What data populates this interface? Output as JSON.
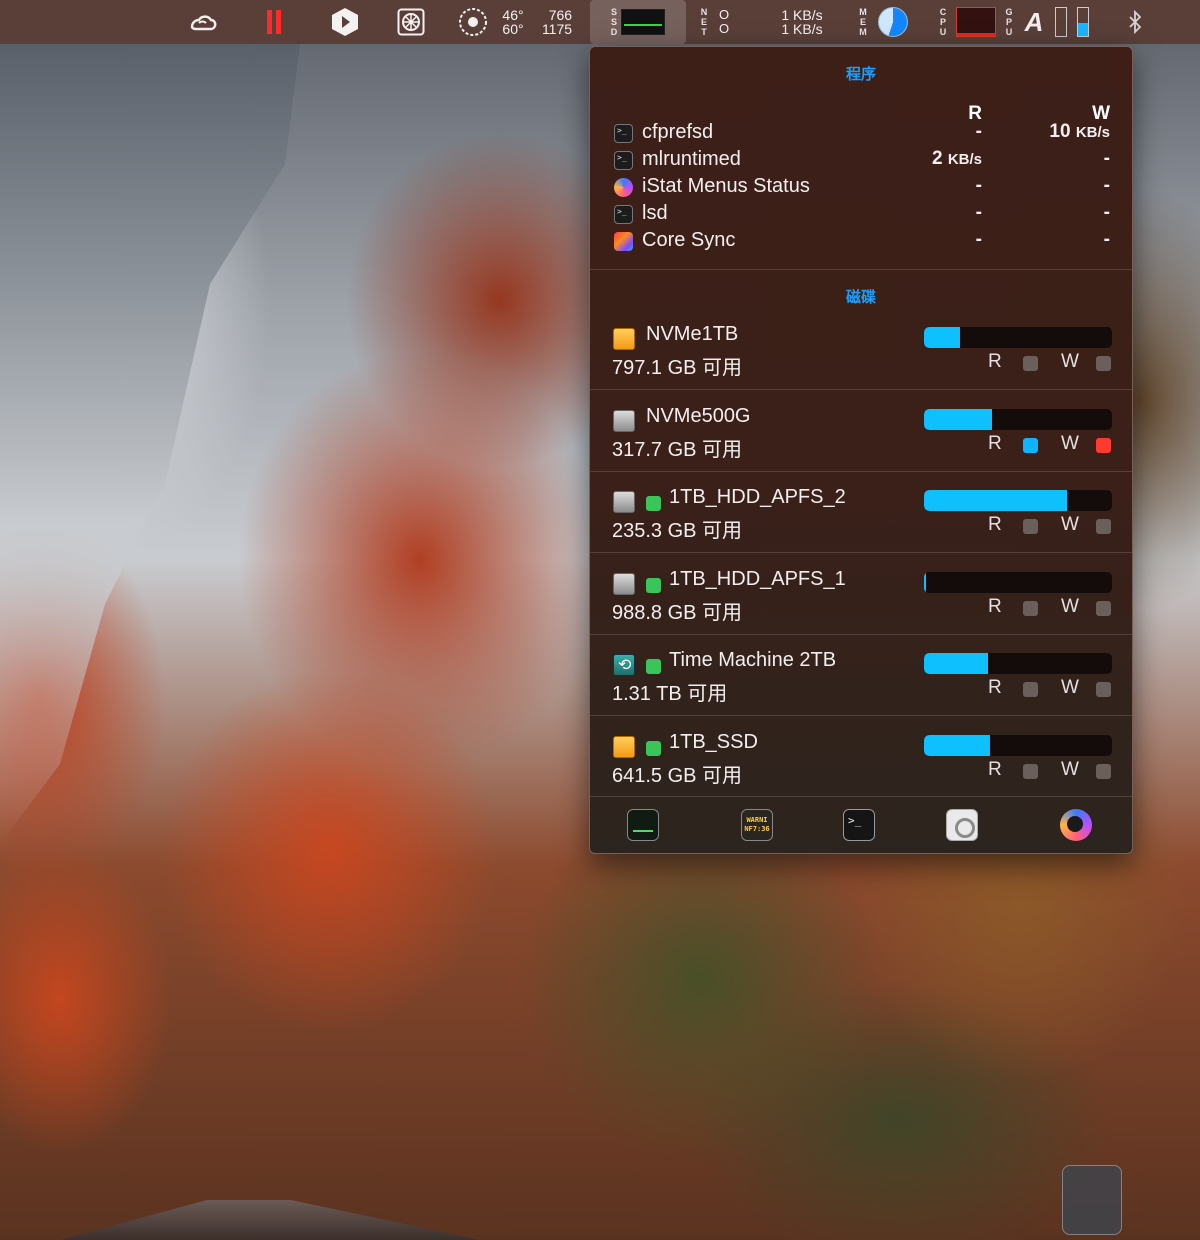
{
  "menubar": {
    "temps": [
      "46°",
      "60°"
    ],
    "fans": [
      "766",
      "1175"
    ],
    "ssd_label": [
      "S",
      "S",
      "D"
    ],
    "net_label": [
      "N",
      "E",
      "T"
    ],
    "net_dots": [
      "O",
      "O"
    ],
    "net_rates": [
      "1 KB/s",
      "1 KB/s"
    ],
    "mem_label": [
      "M",
      "E",
      "M"
    ],
    "cpu_label": [
      "C",
      "P",
      "U"
    ],
    "gpu_label": [
      "G",
      "P",
      "U"
    ],
    "font_icon": "A",
    "memory_fraction": 0.55,
    "gpu_fraction": 0.45
  },
  "panel": {
    "processes_title": "程序",
    "col_read": "R",
    "col_write": "W",
    "processes": [
      {
        "name": "cfprefsd",
        "icon": "terminal-icon",
        "read": "-",
        "write_value": "10",
        "write_unit": "KB/s"
      },
      {
        "name": "mlruntimed",
        "icon": "terminal-icon",
        "read_value": "2",
        "read_unit": "KB/s",
        "write": "-"
      },
      {
        "name": "iStat Menus Status",
        "icon": "istat-icon",
        "read": "-",
        "write": "-"
      },
      {
        "name": "lsd",
        "icon": "terminal-icon",
        "read": "-",
        "write": "-"
      },
      {
        "name": "Core Sync",
        "icon": "creative-cloud-icon",
        "read": "-",
        "write": "-"
      }
    ],
    "disks_title": "磁碟",
    "rw_read": "R",
    "rw_write": "W",
    "disks": [
      {
        "name": "NVMe1TB",
        "free": "797.1 GB 可用",
        "icon": "orange-disk-icon",
        "mounted_dot": false,
        "used_fraction": 0.19,
        "read_active": false,
        "write_active": false
      },
      {
        "name": "NVMe500G",
        "free": "317.7 GB 可用",
        "icon": "grey-disk-icon",
        "mounted_dot": false,
        "used_fraction": 0.36,
        "read_active": true,
        "write_active": true
      },
      {
        "name": "1TB_HDD_APFS_2",
        "free": "235.3 GB 可用",
        "icon": "grey-disk-icon",
        "mounted_dot": true,
        "used_fraction": 0.76,
        "read_active": false,
        "write_active": false
      },
      {
        "name": "1TB_HDD_APFS_1",
        "free": "988.8 GB 可用",
        "icon": "grey-disk-icon",
        "mounted_dot": true,
        "used_fraction": 0.01,
        "read_active": false,
        "write_active": false
      },
      {
        "name": "Time Machine 2TB",
        "free": "1.31 TB 可用",
        "icon": "time-machine-icon",
        "mounted_dot": true,
        "used_fraction": 0.34,
        "read_active": false,
        "write_active": false
      },
      {
        "name": "1TB_SSD",
        "free": "641.5 GB 可用",
        "icon": "orange-disk-icon",
        "mounted_dot": true,
        "used_fraction": 0.35,
        "read_active": false,
        "write_active": false
      }
    ],
    "colors": {
      "accent": "#1ba0ff",
      "bar_fill": "#0fc0ff",
      "read_active": "#0fb4ff",
      "write_active": "#ff3b30",
      "inactive": "#6b5f5c",
      "mounted": "#39c55a"
    },
    "console_icon_text": [
      "WARNI",
      "NF7:36"
    ],
    "footer": [
      "activity-monitor-icon",
      "console-icon",
      "terminal-icon",
      "disk-utility-icon",
      "istat-icon"
    ]
  }
}
